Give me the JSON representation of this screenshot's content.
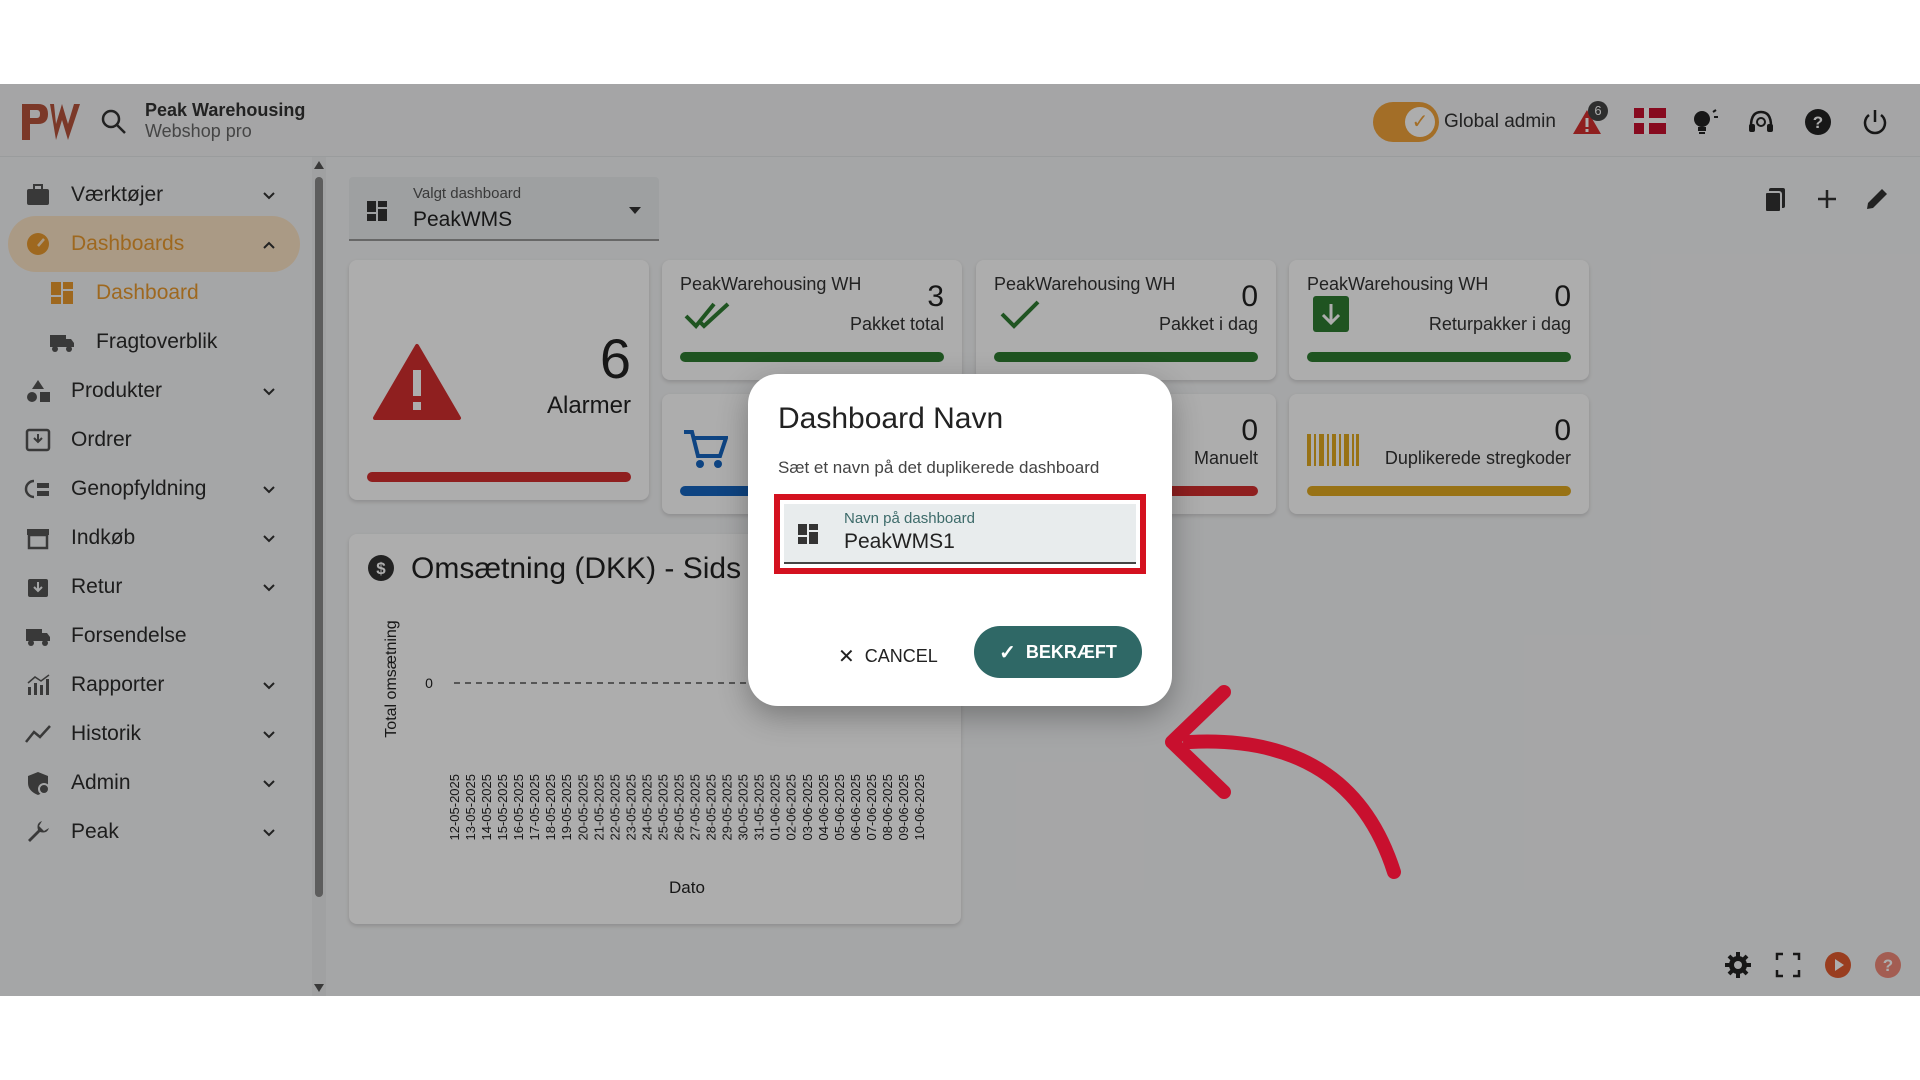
{
  "header": {
    "brand_title": "Peak Warehousing",
    "brand_subtitle": "Webshop pro",
    "admin_label": "Global admin",
    "alarm_count": "6"
  },
  "sidebar": {
    "items": [
      {
        "label": "Værktøjer",
        "icon": "toolbox-icon",
        "expandable": true
      },
      {
        "label": "Dashboards",
        "icon": "gauge-icon",
        "expandable": true,
        "active": true
      },
      {
        "label": "Dashboard",
        "icon": "dashboard-grid-icon",
        "sub": true,
        "active": true
      },
      {
        "label": "Fragtoverblik",
        "icon": "truck-icon",
        "sub": true
      },
      {
        "label": "Produkter",
        "icon": "shapes-icon",
        "expandable": true
      },
      {
        "label": "Ordrer",
        "icon": "inbox-icon",
        "expandable": false
      },
      {
        "label": "Genopfyldning",
        "icon": "replenish-icon",
        "expandable": true
      },
      {
        "label": "Indkøb",
        "icon": "store-icon",
        "expandable": true
      },
      {
        "label": "Retur",
        "icon": "return-box-icon",
        "expandable": true
      },
      {
        "label": "Forsendelse",
        "icon": "shipping-truck-icon",
        "expandable": false
      },
      {
        "label": "Rapporter",
        "icon": "chart-icon",
        "expandable": true
      },
      {
        "label": "Historik",
        "icon": "trend-icon",
        "expandable": true
      },
      {
        "label": "Admin",
        "icon": "admin-shield-icon",
        "expandable": true
      },
      {
        "label": "Peak",
        "icon": "wrench-icon",
        "expandable": true
      }
    ]
  },
  "dashboard_select": {
    "label": "Valgt dashboard",
    "value": "PeakWMS"
  },
  "cards": {
    "alarms": {
      "number": "6",
      "label": "Alarmer",
      "bar_color": "#d32f2f"
    },
    "packed_total": {
      "title": "PeakWarehousing WH",
      "number": "3",
      "label": "Pakket total",
      "bar_color": "#2e7d32"
    },
    "packed_today": {
      "title": "PeakWarehousing WH",
      "number": "0",
      "label": "Pakket i dag",
      "bar_color": "#2e7d32"
    },
    "returns_today": {
      "title": "PeakWarehousing WH",
      "number": "0",
      "label": "Returpakker i dag",
      "bar_color": "#2e7d32"
    },
    "manual": {
      "number": "0",
      "label": "Manuelt",
      "bar_color": "#d32f2f"
    },
    "dup_barcodes": {
      "number": "0",
      "label": "Duplikerede stregkoder",
      "bar_color": "#e0a91f"
    },
    "cart_bar_color": "#1565c0"
  },
  "chart": {
    "title": "Omsætning (DKK) - Sids",
    "ylabel": "Total omsætning",
    "xlabel": "Dato",
    "y_tick": "0",
    "dates": [
      "12-05-2025",
      "13-05-2025",
      "14-05-2025",
      "15-05-2025",
      "16-05-2025",
      "17-05-2025",
      "18-05-2025",
      "19-05-2025",
      "20-05-2025",
      "21-05-2025",
      "22-05-2025",
      "23-05-2025",
      "24-05-2025",
      "25-05-2025",
      "26-05-2025",
      "27-05-2025",
      "28-05-2025",
      "29-05-2025",
      "30-05-2025",
      "31-05-2025",
      "01-06-2025",
      "02-06-2025",
      "03-06-2025",
      "04-06-2025",
      "05-06-2025",
      "06-06-2025",
      "07-06-2025",
      "08-06-2025",
      "09-06-2025",
      "10-06-2025"
    ]
  },
  "dialog": {
    "title": "Dashboard Navn",
    "text": "Sæt et navn på det duplikerede dashboard",
    "field_label": "Navn på dashboard",
    "field_value": "PeakWMS1",
    "cancel_label": "CANCEL",
    "confirm_label": "BEKRÆFT"
  },
  "colors": {
    "accent": "#f0a23a",
    "confirm": "#2f6866",
    "highlight": "#d4111f"
  }
}
